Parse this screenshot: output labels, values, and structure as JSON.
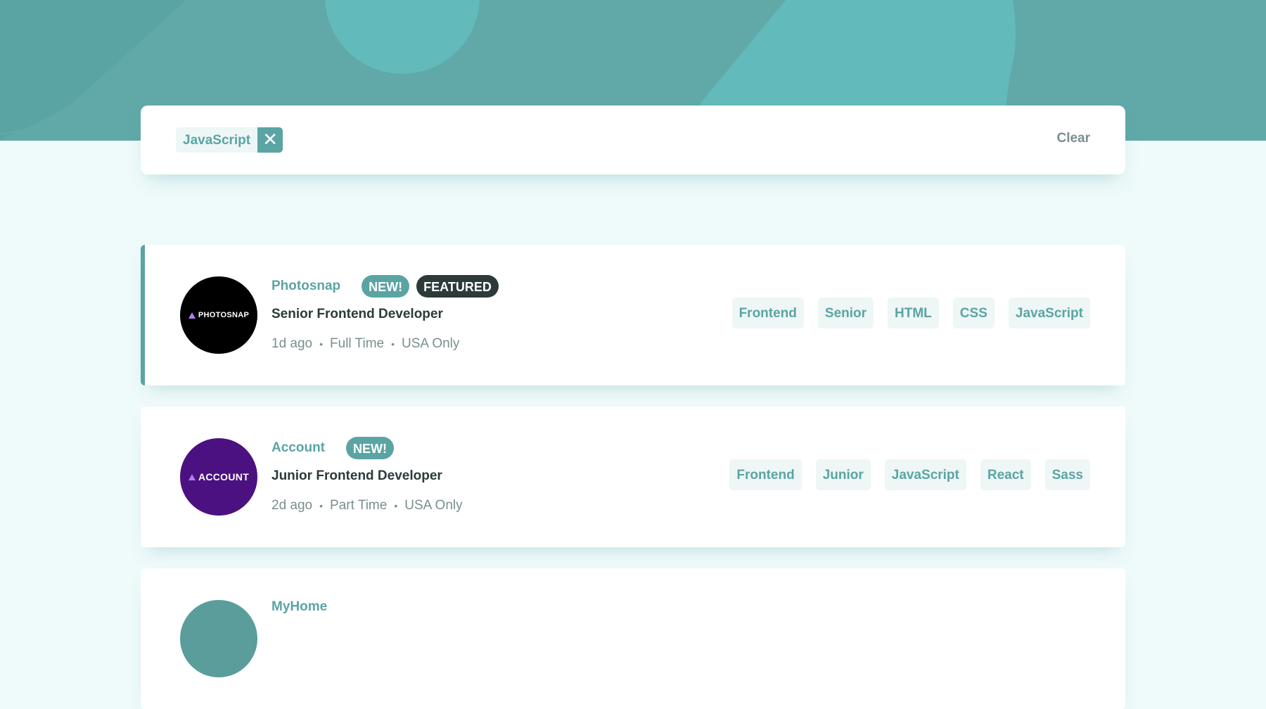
{
  "colors": {
    "accent": "#5ba4a4",
    "background": "#effafa",
    "dark": "#2c3a3a",
    "muted": "#7b8e8e",
    "tag_bg": "#eef6f6"
  },
  "filter_bar": {
    "chips": [
      {
        "label": "JavaScript",
        "remove_icon": "close-icon"
      }
    ],
    "clear_label": "Clear"
  },
  "jobs": [
    {
      "company": "Photosnap",
      "logo_text": "PHOTOSNAP",
      "logo_color": "#000000",
      "new_label": "NEW!",
      "featured_label": "FEATURED",
      "position": "Senior Frontend Developer",
      "posted": "1d ago",
      "contract": "Full Time",
      "location": "USA Only",
      "tags": [
        "Frontend",
        "Senior",
        "HTML",
        "CSS",
        "JavaScript"
      ]
    },
    {
      "company": "Account",
      "logo_text": "ACCOUNT",
      "logo_color": "#4b1180",
      "new_label": "NEW!",
      "position": "Junior Frontend Developer",
      "posted": "2d ago",
      "contract": "Part Time",
      "location": "USA Only",
      "tags": [
        "Frontend",
        "Junior",
        "JavaScript",
        "React",
        "Sass"
      ]
    },
    {
      "company": "MyHome",
      "logo_color": "#5a9d9a"
    }
  ]
}
